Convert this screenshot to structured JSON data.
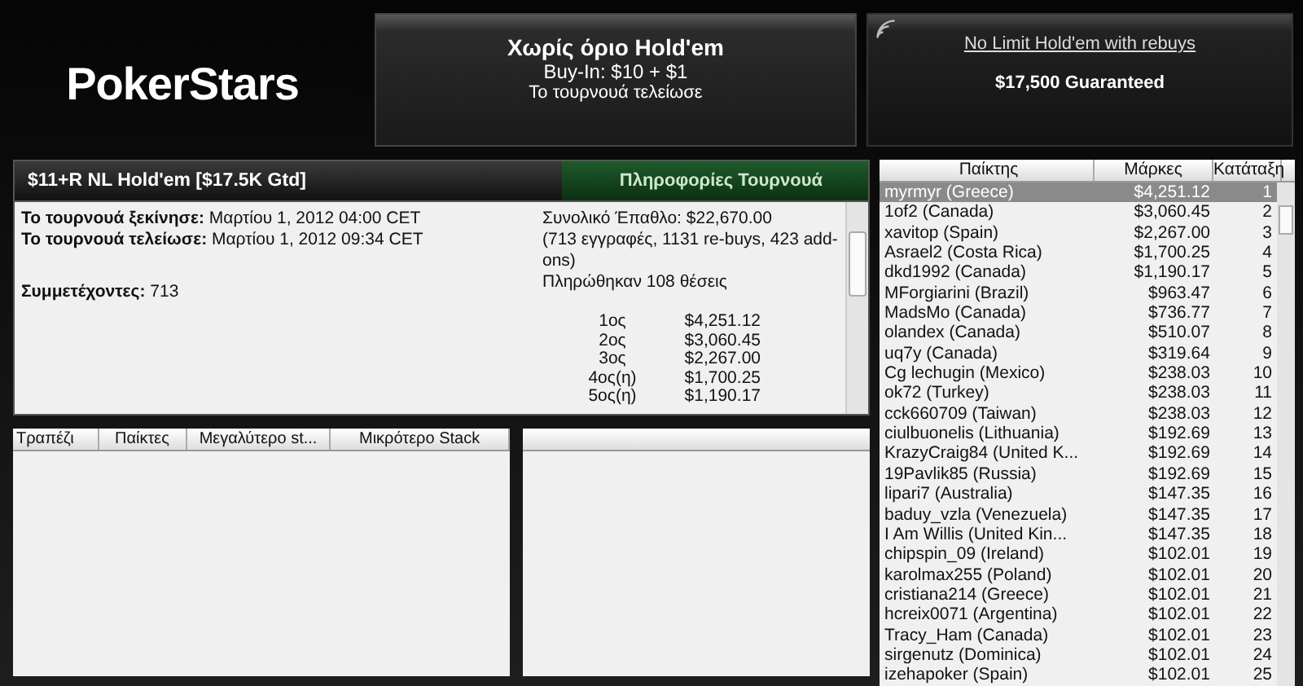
{
  "logo": "PokerStars",
  "game_box": {
    "title": "Χωρίς όριο Hold'em",
    "buy_in": "Buy-In: $10 + $1",
    "status": "Το τουρνουά τελείωσε"
  },
  "promo_box": {
    "link": "No Limit Hold'em with rebuys",
    "guarantee": "$17,500 Guaranteed"
  },
  "tournament": {
    "title": "$11+R NL Hold'em [$17.5K Gtd]",
    "info_tab": "Πληροφορίες Τουρνουά",
    "details": [
      "**Το τουρνουά ξεκίνησε:** Μαρτίου 1, 2012 04:00 CET",
      "**Το τουρνουά τελείωσε:** Μαρτίου 1, 2012 09:34 CET"
    ],
    "entrants": "**Συμμετέχοντες:** 713",
    "prize_pool": "Συνολικό Έπαθλο: $22,670.00",
    "entries_note": "(713 εγγραφές, 1131 re-buys, 423 add-ons)",
    "paid": "Πληρώθηκαν 108 θέσεις",
    "payouts": [
      {
        "place": "1ος",
        "prize": "$4,251.12"
      },
      {
        "place": "2ος",
        "prize": "$3,060.45"
      },
      {
        "place": "3ος",
        "prize": "$2,267.00"
      },
      {
        "place": "4ος(η)",
        "prize": "$1,700.25"
      },
      {
        "place": "5ος(η)",
        "prize": "$1,190.17"
      }
    ]
  },
  "tables": {
    "columns": [
      "Τραπέζι",
      "Παίκτες",
      "Μεγαλύτερο st...",
      "Μικρότερο Stack"
    ]
  },
  "players": {
    "columns": [
      "Παίκτης",
      "Μάρκες",
      "Κατάταξη"
    ],
    "rows": [
      {
        "name": "myrmyr (Greece)",
        "chips": "$4,251.12",
        "rank": "1",
        "selected": true
      },
      {
        "name": "1of2 (Canada)",
        "chips": "$3,060.45",
        "rank": "2",
        "selected": false
      },
      {
        "name": "xavitop (Spain)",
        "chips": "$2,267.00",
        "rank": "3",
        "selected": false
      },
      {
        "name": "Asrael2 (Costa Rica)",
        "chips": "$1,700.25",
        "rank": "4",
        "selected": false
      },
      {
        "name": "dkd1992 (Canada)",
        "chips": "$1,190.17",
        "rank": "5",
        "selected": false
      },
      {
        "name": "MForgiarini (Brazil)",
        "chips": "$963.47",
        "rank": "6",
        "selected": false
      },
      {
        "name": "MadsMo (Canada)",
        "chips": "$736.77",
        "rank": "7",
        "selected": false
      },
      {
        "name": "olandex (Canada)",
        "chips": "$510.07",
        "rank": "8",
        "selected": false
      },
      {
        "name": "uq7y (Canada)",
        "chips": "$319.64",
        "rank": "9",
        "selected": false
      },
      {
        "name": "Cg lechugin (Mexico)",
        "chips": "$238.03",
        "rank": "10",
        "selected": false
      },
      {
        "name": "ok72 (Turkey)",
        "chips": "$238.03",
        "rank": "11",
        "selected": false
      },
      {
        "name": "cck660709 (Taiwan)",
        "chips": "$238.03",
        "rank": "12",
        "selected": false
      },
      {
        "name": "ciulbuonelis (Lithuania)",
        "chips": "$192.69",
        "rank": "13",
        "selected": false
      },
      {
        "name": "KrazyCraig84 (United K...",
        "chips": "$192.69",
        "rank": "14",
        "selected": false
      },
      {
        "name": "19Pavlik85 (Russia)",
        "chips": "$192.69",
        "rank": "15",
        "selected": false
      },
      {
        "name": "lipari7 (Australia)",
        "chips": "$147.35",
        "rank": "16",
        "selected": false
      },
      {
        "name": "baduy_vzla (Venezuela)",
        "chips": "$147.35",
        "rank": "17",
        "selected": false
      },
      {
        "name": "I Am Willis (United Kin...",
        "chips": "$147.35",
        "rank": "18",
        "selected": false
      },
      {
        "name": "chipspin_09 (Ireland)",
        "chips": "$102.01",
        "rank": "19",
        "selected": false
      },
      {
        "name": "karolmax255 (Poland)",
        "chips": "$102.01",
        "rank": "20",
        "selected": false
      },
      {
        "name": "cristiana214 (Greece)",
        "chips": "$102.01",
        "rank": "21",
        "selected": false
      },
      {
        "name": "hcreix0071 (Argentina)",
        "chips": "$102.01",
        "rank": "22",
        "selected": false
      },
      {
        "name": "Tracy_Ham (Canada)",
        "chips": "$102.01",
        "rank": "23",
        "selected": false
      },
      {
        "name": "sirgenutz (Dominica)",
        "chips": "$102.01",
        "rank": "24",
        "selected": false
      },
      {
        "name": "izehapoker (Spain)",
        "chips": "$102.01",
        "rank": "25",
        "selected": false
      }
    ]
  }
}
